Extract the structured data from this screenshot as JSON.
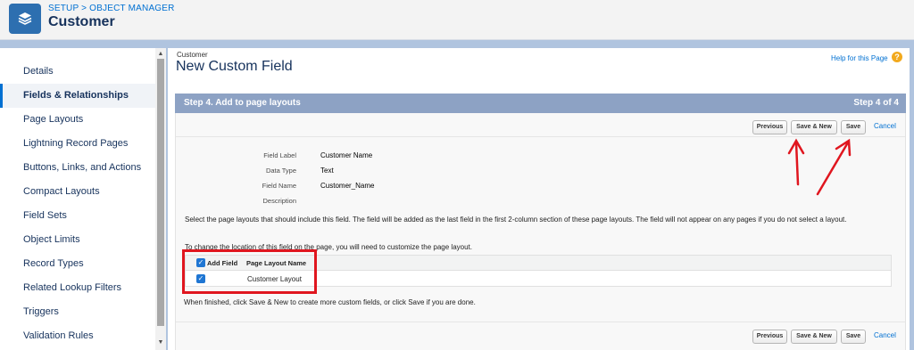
{
  "header": {
    "breadcrumb_setup": "SETUP",
    "breadcrumb_sep": " > ",
    "breadcrumb_object_manager": "OBJECT MANAGER",
    "title": "Customer",
    "icon": "stack-layers-icon"
  },
  "sidebar": {
    "items": [
      {
        "label": "Details"
      },
      {
        "label": "Fields & Relationships",
        "active": true
      },
      {
        "label": "Page Layouts"
      },
      {
        "label": "Lightning Record Pages"
      },
      {
        "label": "Buttons, Links, and Actions"
      },
      {
        "label": "Compact Layouts"
      },
      {
        "label": "Field Sets"
      },
      {
        "label": "Object Limits"
      },
      {
        "label": "Record Types"
      },
      {
        "label": "Related Lookup Filters"
      },
      {
        "label": "Triggers"
      },
      {
        "label": "Validation Rules"
      }
    ]
  },
  "main": {
    "object_label": "Customer",
    "form_title": "New Custom Field",
    "help_link": "Help for this Page",
    "help_icon": "?",
    "step_title": "Step 4. Add to page layouts",
    "step_count": "Step 4 of 4",
    "buttons": {
      "previous": "Previous",
      "save_new": "Save & New",
      "save": "Save",
      "cancel": "Cancel"
    },
    "fields": [
      {
        "label": "Field Label",
        "value": "Customer Name"
      },
      {
        "label": "Data Type",
        "value": "Text"
      },
      {
        "label": "Field Name",
        "value": "Customer_Name"
      },
      {
        "label": "Description",
        "value": ""
      }
    ],
    "info_line1": "Select the page layouts that should include this field. The field will be added as the last field in the first 2-column section of these page layouts. The field will not appear on any pages if you do not select a layout.",
    "info_line2": "To change the location of this field on the page, you will need to customize the page layout.",
    "table": {
      "col_add_field": "Add Field",
      "col_layout_name": "Page Layout Name",
      "rows": [
        {
          "layout_name": "Customer Layout",
          "checked": true
        }
      ]
    },
    "done_text": "When finished, click Save & New to create more custom fields, or click Save if you are done."
  },
  "colors": {
    "accent": "#0070d2",
    "step_bar": "#8da2c4",
    "annotation_red": "#e0161f",
    "page_bg": "#b0c4df"
  }
}
